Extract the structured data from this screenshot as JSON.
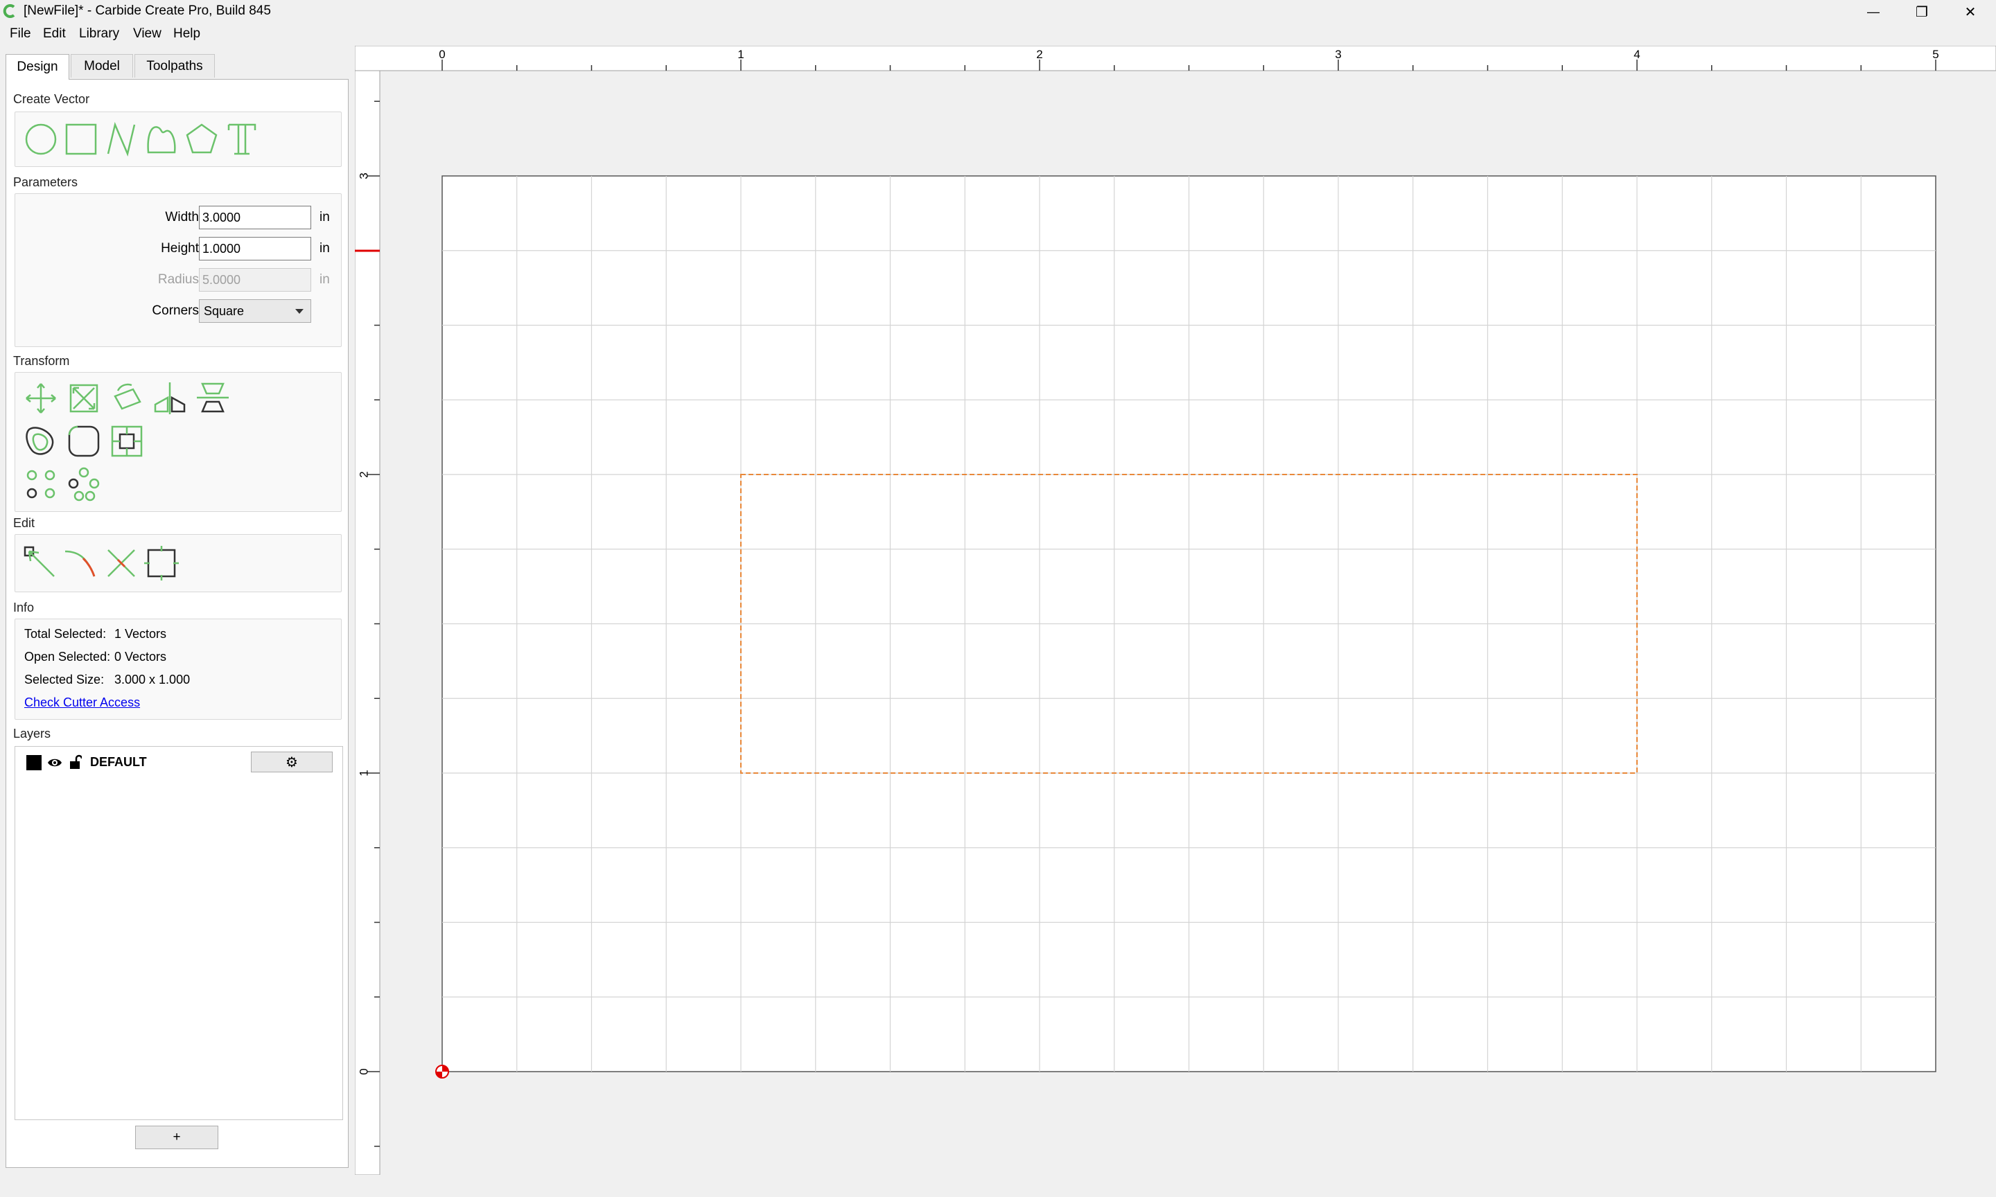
{
  "window": {
    "title": "[NewFile]* - Carbide Create Pro, Build 845",
    "minimize_glyph": "—",
    "restore_glyph": "❐",
    "close_glyph": "✕"
  },
  "menu": {
    "items": [
      "File",
      "Edit",
      "Library",
      "View",
      "Help"
    ]
  },
  "tabs": [
    {
      "label": "Design",
      "active": true
    },
    {
      "label": "Model",
      "active": false
    },
    {
      "label": "Toolpaths",
      "active": false
    }
  ],
  "sections": {
    "create_vector": "Create Vector",
    "parameters": "Parameters",
    "transform": "Transform",
    "edit": "Edit",
    "info": "Info",
    "layers": "Layers"
  },
  "create_vector_icons": [
    "circle-icon",
    "rectangle-icon",
    "polyline-icon",
    "curve-icon",
    "polygon-icon",
    "text-icon"
  ],
  "parameters": {
    "width_label": "Width",
    "width_value": "3.0000",
    "height_label": "Height",
    "height_value": "1.0000",
    "radius_label": "Radius",
    "radius_value": "5.0000",
    "unit": "in",
    "corners_label": "Corners",
    "corners_value": "Square"
  },
  "info": {
    "total_selected_label": "Total Selected:",
    "total_selected_value": "1 Vectors",
    "open_selected_label": "Open Selected:",
    "open_selected_value": "0 Vectors",
    "selected_size_label": "Selected Size:",
    "selected_size_value": "3.000 x 1.000",
    "check_cutter_link": "Check Cutter Access"
  },
  "layers": {
    "items": [
      {
        "name": "DEFAULT",
        "color": "#000000"
      }
    ],
    "add_label": "+",
    "settings_glyph": "⚙"
  },
  "canvas": {
    "ruler_top_labels": [
      "0",
      "1",
      "2",
      "3",
      "4",
      "5"
    ],
    "ruler_left_labels": [
      "3",
      "2",
      "1",
      "0"
    ],
    "stock_width_in": 5,
    "stock_height_in": 3,
    "grid_step_in": 0.25,
    "selected_rect": {
      "x": 1,
      "y": 1,
      "width": 3,
      "height": 1
    },
    "selection_color": "#e8883a",
    "origin_color": "#e00000",
    "accent_green": "#6bc26b"
  }
}
